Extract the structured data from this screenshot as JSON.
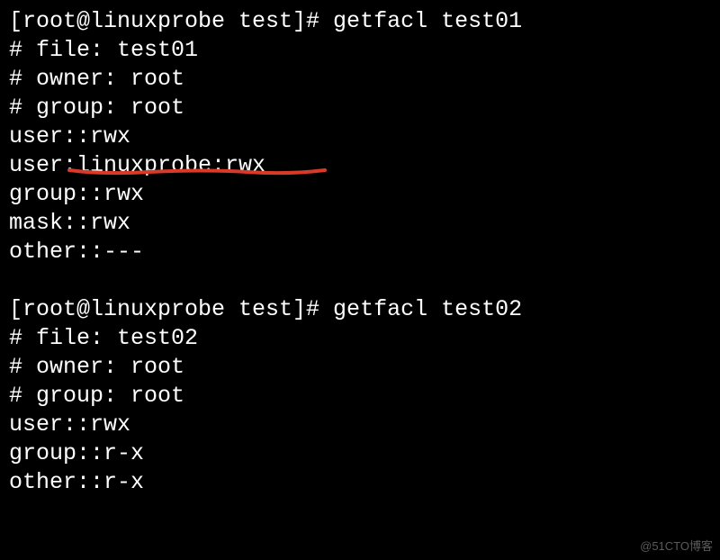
{
  "block1": {
    "prompt": "[root@linuxprobe test]# getfacl test01",
    "file": "# file: test01",
    "owner": "# owner: root",
    "group": "# group: root",
    "acl_user": "user::rwx",
    "acl_user_named": "user:linuxprobe:rwx",
    "acl_group": "group::rwx",
    "acl_mask": "mask::rwx",
    "acl_other": "other::---"
  },
  "block2": {
    "prompt": "[root@linuxprobe test]# getfacl test02",
    "file": "# file: test02",
    "owner": "# owner: root",
    "group": "# group: root",
    "acl_user": "user::rwx",
    "acl_group": "group::r-x",
    "acl_other": "other::r-x"
  },
  "watermark": "@51CTO博客",
  "blank": " "
}
